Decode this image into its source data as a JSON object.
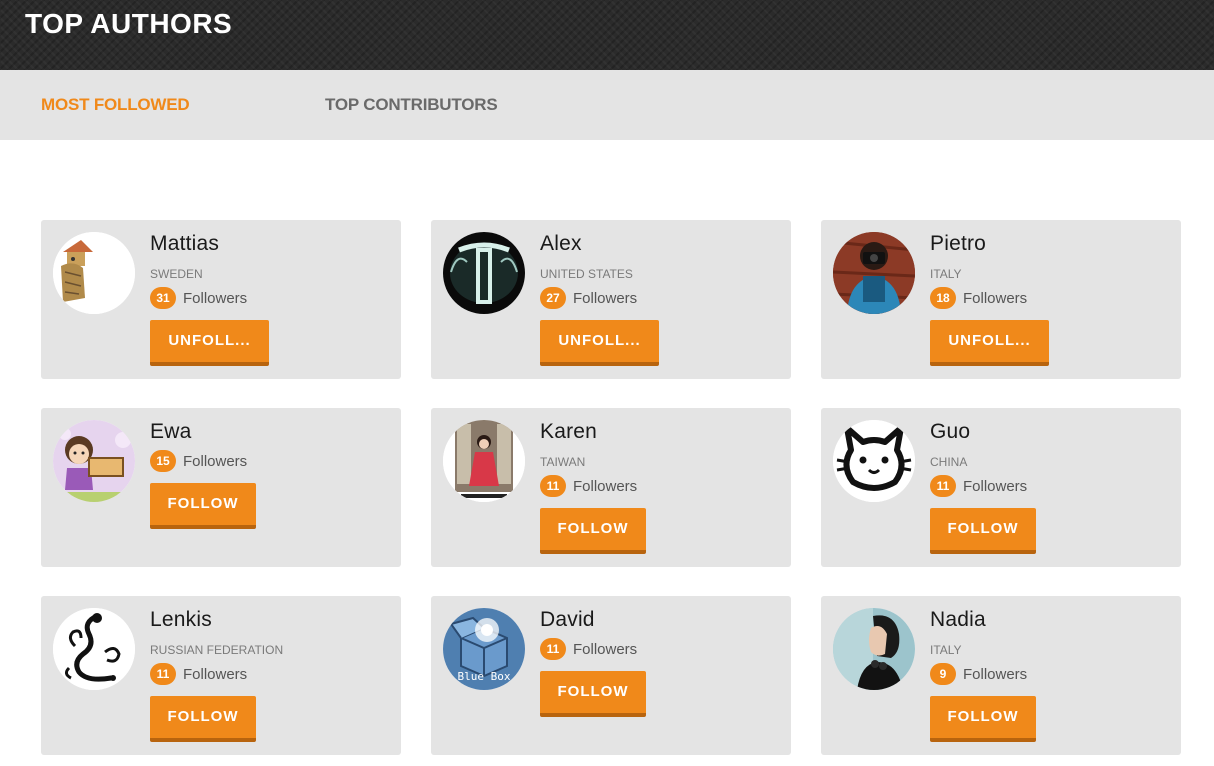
{
  "header": {
    "title": "TOP AUTHORS"
  },
  "tabs": [
    {
      "label": "MOST FOLLOWED",
      "active": true
    },
    {
      "label": "TOP CONTRIBUTORS",
      "active": false
    }
  ],
  "colors": {
    "accent": "#f0891a",
    "header_bg": "#2b2b2b",
    "card_bg": "#e4e4e4"
  },
  "followers_label": "Followers",
  "authors": [
    {
      "name": "Mattias",
      "country": "SWEDEN",
      "followers": "31",
      "button": "UNFOLL...",
      "avatar": "illustration-avatar"
    },
    {
      "name": "Alex",
      "country": "UNITED STATES",
      "followers": "27",
      "button": "UNFOLL...",
      "avatar": "neon-letter-avatar"
    },
    {
      "name": "Pietro",
      "country": "ITALY",
      "followers": "18",
      "button": "UNFOLL...",
      "avatar": "photographer-avatar"
    },
    {
      "name": "Ewa",
      "country": "",
      "followers": "15",
      "button": "FOLLOW",
      "avatar": "cartoon-girl-avatar"
    },
    {
      "name": "Karen",
      "country": "TAIWAN",
      "followers": "11",
      "button": "FOLLOW",
      "avatar": "kimono-photo-avatar"
    },
    {
      "name": "Guo",
      "country": "CHINA",
      "followers": "11",
      "button": "FOLLOW",
      "avatar": "cat-drawing-avatar"
    },
    {
      "name": "Lenkis",
      "country": "RUSSIAN FEDERATION",
      "followers": "11",
      "button": "FOLLOW",
      "avatar": "ornament-letter-avatar"
    },
    {
      "name": "David",
      "country": "",
      "followers": "11",
      "button": "FOLLOW",
      "avatar": "blue-box-avatar",
      "avatar_text": "Blue Box"
    },
    {
      "name": "Nadia",
      "country": "ITALY",
      "followers": "9",
      "button": "FOLLOW",
      "avatar": "portrait-avatar"
    }
  ]
}
